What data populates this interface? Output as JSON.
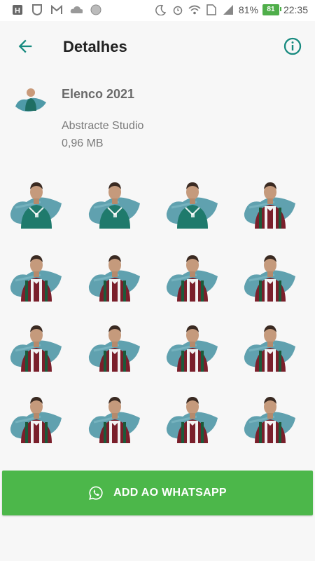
{
  "status_bar": {
    "battery_percent": "81%",
    "battery_level": "81",
    "time": "22:35",
    "icons": [
      "h-icon",
      "shield-icon",
      "gmail-icon",
      "cloud-icon",
      "circle-icon",
      "moon-icon",
      "alarm-icon",
      "wifi-icon",
      "sim-icon",
      "signal-icon",
      "battery-icon"
    ]
  },
  "appbar": {
    "title": "Detalhes",
    "back_icon": "arrow-back-icon",
    "info_icon": "info-icon",
    "accent_color": "#178a7f"
  },
  "pack": {
    "name": "Elenco 2021",
    "publisher": "Abstracte Studio",
    "size": "0,96 MB"
  },
  "stickers": [
    {
      "kit": "green"
    },
    {
      "kit": "green"
    },
    {
      "kit": "green"
    },
    {
      "kit": "tricolor"
    },
    {
      "kit": "tricolor"
    },
    {
      "kit": "tricolor"
    },
    {
      "kit": "tricolor"
    },
    {
      "kit": "tricolor"
    },
    {
      "kit": "tricolor"
    },
    {
      "kit": "tricolor"
    },
    {
      "kit": "tricolor"
    },
    {
      "kit": "tricolor"
    },
    {
      "kit": "tricolor"
    },
    {
      "kit": "tricolor"
    },
    {
      "kit": "tricolor"
    },
    {
      "kit": "tricolor"
    }
  ],
  "add_button": {
    "label": "ADD AO WHATSAPP",
    "color": "#4cb74a"
  }
}
